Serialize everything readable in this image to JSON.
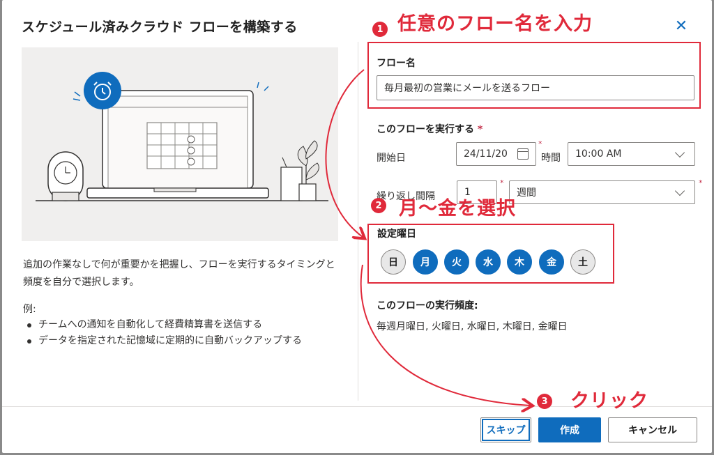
{
  "dialog": {
    "title": "スケジュール済みクラウド フローを構築する",
    "close_glyph": "✕",
    "description": "追加の作業なしで何が重要かを把握し、フローを実行するタイミングと頻度を自分で選択します。",
    "example_label": "例:",
    "examples": [
      "チームへの通知を自動化して経費精算書を送信する",
      "データを指定された記憶域に定期的に自動バックアップする"
    ]
  },
  "form": {
    "flow_name_label": "フロー名",
    "flow_name_value": "毎月最初の営業にメールを送るフロー",
    "run_section_label": "このフローを実行する",
    "required_mark": "*",
    "start_date_label": "開始日",
    "start_date_value": "24/11/20",
    "time_label": "時間",
    "time_value": "10:00 AM",
    "repeat_label": "繰り返し間隔",
    "repeat_value": "1",
    "repeat_unit": "週間",
    "weekdays_label": "設定曜日",
    "weekdays": [
      {
        "label": "日",
        "selected": false
      },
      {
        "label": "月",
        "selected": true
      },
      {
        "label": "火",
        "selected": true
      },
      {
        "label": "水",
        "selected": true
      },
      {
        "label": "木",
        "selected": true
      },
      {
        "label": "金",
        "selected": true
      },
      {
        "label": "土",
        "selected": false
      }
    ],
    "frequency_label": "このフローの実行頻度:",
    "frequency_value": "毎週月曜日, 火曜日, 水曜日, 木曜日, 金曜日"
  },
  "buttons": {
    "skip": "スキップ",
    "create": "作成",
    "cancel": "キャンセル"
  },
  "annotations": {
    "step1_number": "1",
    "step1_text": "任意のフロー名を入力",
    "step2_number": "2",
    "step2_text": "月〜金を選択",
    "step3_number": "3",
    "step3_text": "クリック",
    "color": "#e0293a"
  },
  "colors": {
    "accent": "#0f6cbd",
    "annotation_red": "#e0293a"
  }
}
